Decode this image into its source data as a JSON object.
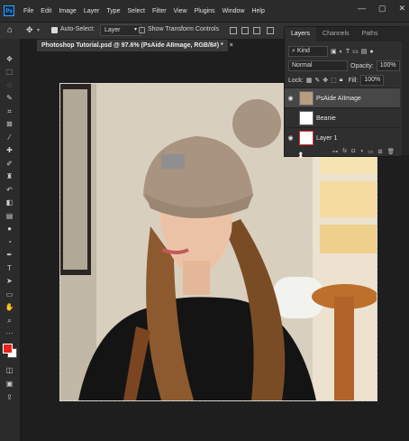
{
  "menubar": {
    "logo": "Ps",
    "items": [
      "File",
      "Edit",
      "Image",
      "Layer",
      "Type",
      "Select",
      "Filter",
      "View",
      "Plugins",
      "Window",
      "Help"
    ],
    "window_controls": [
      "—",
      "▢",
      "✕"
    ]
  },
  "options": {
    "auto_select_label": "Auto-Select:",
    "auto_select_checked": true,
    "auto_select_target": "Layer",
    "show_transform_label": "Show Transform Controls",
    "show_transform_checked": false
  },
  "document": {
    "tab_title": "Photoshop Tutorial.psd @ 97.6% (PsAide AIImage, RGB/8#) *",
    "tab_close": "×"
  },
  "layers_panel": {
    "tabs": [
      "Layers",
      "Channels",
      "Paths"
    ],
    "active_tab": "Layers",
    "filter_label": "Kind",
    "blend_mode": "Normal",
    "opacity_label": "Opacity:",
    "opacity_value": "100%",
    "lock_label": "Lock:",
    "fill_label": "Fill:",
    "fill_value": "100%",
    "layers": [
      {
        "name": "PsAide AIImage",
        "visible": true,
        "selected": true
      },
      {
        "name": "Beanie",
        "visible": false,
        "selected": false
      },
      {
        "name": "Layer 1",
        "visible": true,
        "selected": false
      }
    ],
    "footer_icons": [
      "link-icon",
      "fx-icon",
      "mask-icon",
      "adjustment-icon",
      "group-icon",
      "new-layer-icon",
      "trash-icon"
    ],
    "footer_fx": "fx"
  },
  "colors": {
    "foreground": "#e8231c",
    "background": "#ffffff",
    "accent": "#31a8ff"
  }
}
